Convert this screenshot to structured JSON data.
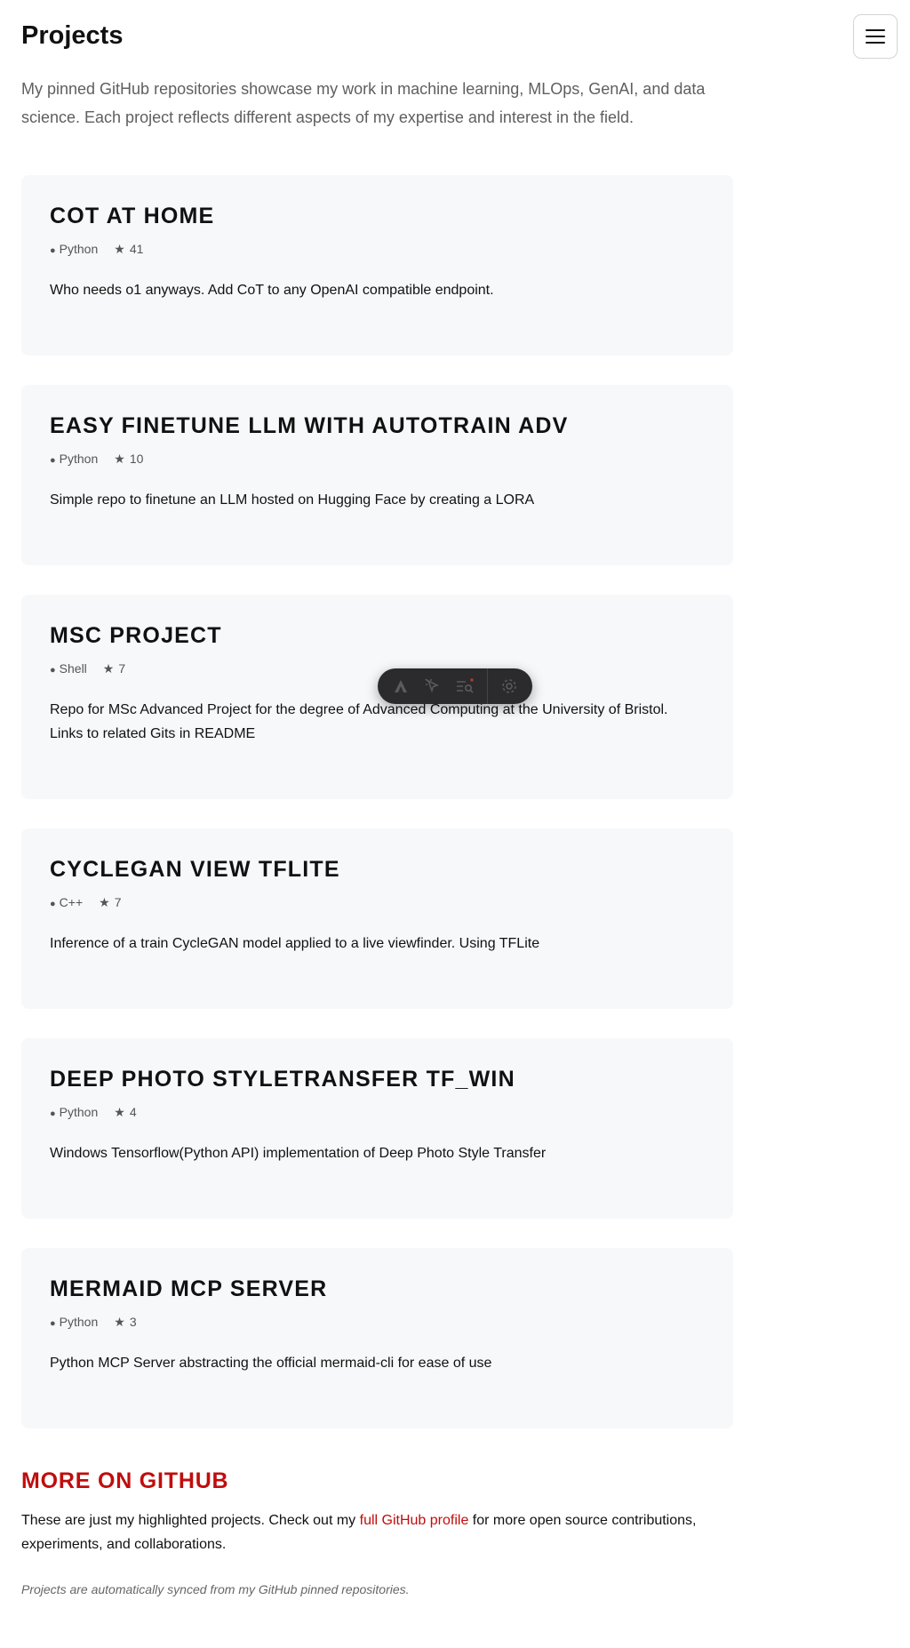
{
  "header": {
    "title": "Projects",
    "menu_icon": "hamburger-icon"
  },
  "intro": "My pinned GitHub repositories showcase my work in machine learning, MLOps, GenAI, and data science. Each project reflects different aspects of my expertise and interest in the field.",
  "projects": [
    {
      "title": "COT AT HOME",
      "language": "Python",
      "stars": "41",
      "description": "Who needs o1 anyways. Add CoT to any OpenAI compatible endpoint."
    },
    {
      "title": "EASY FINETUNE LLM WITH AUTOTRAIN ADV",
      "language": "Python",
      "stars": "10",
      "description": "Simple repo to finetune an LLM hosted on Hugging Face by creating a LORA"
    },
    {
      "title": "MSC PROJECT",
      "language": "Shell",
      "stars": "7",
      "description": "Repo for MSc Advanced Project for the degree of Advanced Computing at the University of Bristol. Links to related Gits in README"
    },
    {
      "title": "CYCLEGAN VIEW TFLITE",
      "language": "C++",
      "stars": "7",
      "description": "Inference of a train CycleGAN model applied to a live viewfinder. Using TFLite"
    },
    {
      "title": "DEEP PHOTO STYLETRANSFER TF_WIN",
      "language": "Python",
      "stars": "4",
      "description": "Windows Tensorflow(Python API) implementation of Deep Photo Style Transfer"
    },
    {
      "title": "MERMAID MCP SERVER",
      "language": "Python",
      "stars": "3",
      "description": "Python MCP Server abstracting the official mermaid-cli for ease of use"
    }
  ],
  "more": {
    "title": "MORE ON GITHUB",
    "text_before": "These are just my highlighted projects. Check out my ",
    "link_label": "full GitHub profile",
    "text_after": " for more open source contributions, experiments, and collaborations."
  },
  "footnote": "Projects are automatically synced from my GitHub pinned repositories.",
  "overlay_toolbar": {
    "icons": [
      "logo-icon",
      "cursor-select-icon",
      "list-search-icon",
      "settings-gear-icon"
    ]
  },
  "colors": {
    "accent": "#c00d0d",
    "card_background": "#f7f8fa",
    "toolbar_background": "#2b2b2d"
  }
}
